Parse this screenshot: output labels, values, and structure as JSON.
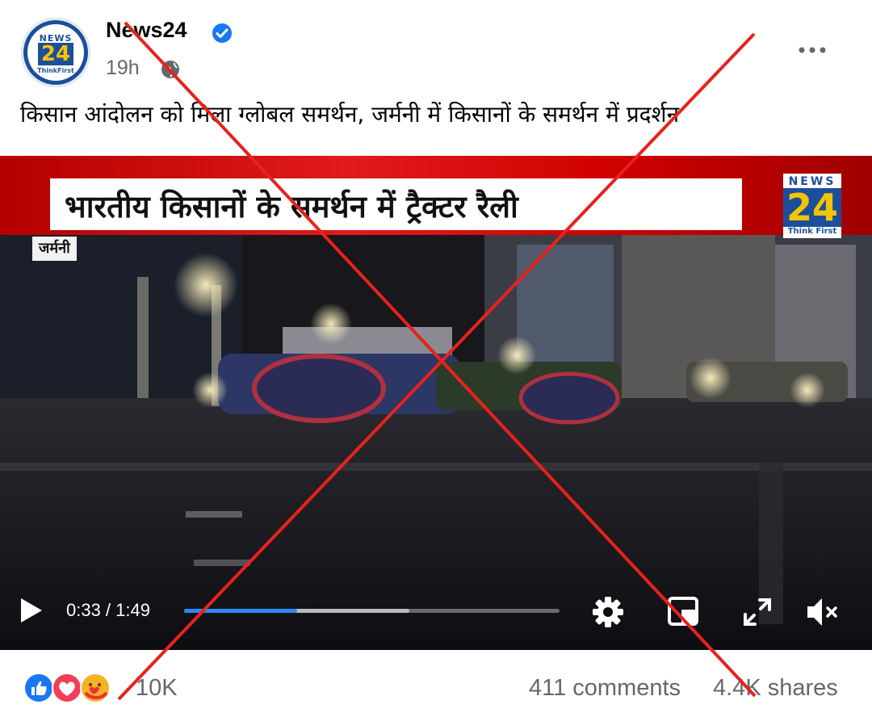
{
  "post": {
    "page_name": "News24",
    "time": "19h",
    "caption": "किसान आंदोलन को मिला ग्लोबल समर्थन, जर्मनी में किसानों के समर्थन में प्रदर्शन",
    "avatar_logo": {
      "top": "NEWS",
      "number": "24",
      "tagline": "ThinkFirst"
    }
  },
  "video": {
    "headline": "भारतीय किसानों के समर्थन में ट्रैक्टर रैली",
    "location_tag": "जर्मनी",
    "logo": {
      "top": "NEWS",
      "number": "24",
      "tagline": "Think First"
    },
    "timecode": "0:33 / 1:49",
    "progress_played": 0.3,
    "progress_buffered": 0.6
  },
  "footer": {
    "reaction_count": "10K",
    "comments": "411 comments",
    "shares": "4.4K shares"
  },
  "colors": {
    "verified": "#1877f2",
    "progress": "#2d88ff",
    "cross": "#e8221c",
    "banner": "#d00000",
    "brand_blue": "#1b4f9c",
    "brand_yellow": "#f5c400"
  },
  "icons": [
    "verified-badge-icon",
    "globe-icon",
    "more-options-icon",
    "play-icon",
    "settings-gear-icon",
    "picture-in-picture-icon",
    "fullscreen-icon",
    "muted-volume-icon",
    "like-reaction-icon",
    "love-reaction-icon",
    "care-reaction-icon"
  ]
}
